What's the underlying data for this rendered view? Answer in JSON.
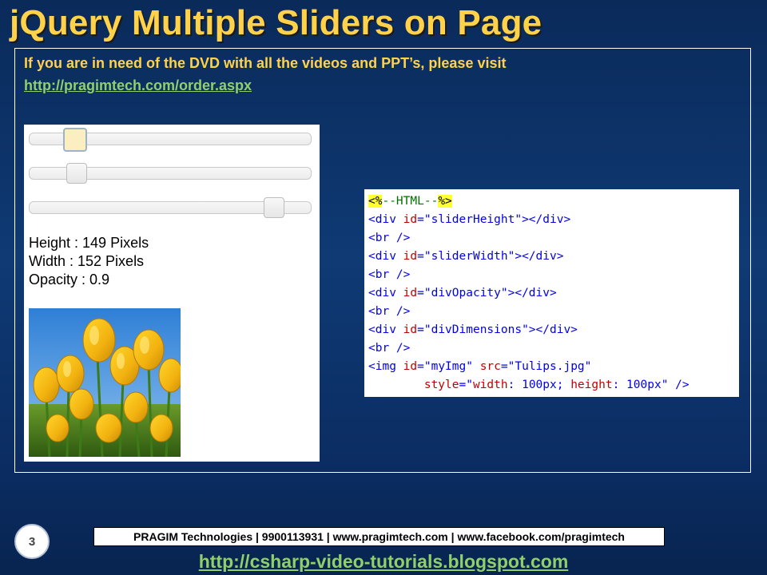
{
  "slide": {
    "title": "jQuery Multiple Sliders on Page",
    "page_number": "3"
  },
  "notice": {
    "text": "If you are in need of the DVD with all the videos and PPT’s, please visit",
    "link": "http://pragimtech.com/order.aspx"
  },
  "demo": {
    "sliders": [
      {
        "name": "height-slider",
        "value_fraction": 0.13,
        "active": true
      },
      {
        "name": "width-slider",
        "value_fraction": 0.14,
        "active": false
      },
      {
        "name": "opacity-slider",
        "value_fraction": 0.9,
        "active": false
      }
    ],
    "height_text": "Height : 149 Pixels",
    "width_text": "Width : 152 Pixels",
    "opacity_text": "Opacity : 0.9",
    "image_subject": "tulips"
  },
  "code": {
    "lines": [
      "<%--HTML--%>",
      "<div id=\"sliderHeight\"></div>",
      "<br />",
      "<div id=\"sliderWidth\"></div>",
      "<br />",
      "<div id=\"divOpacity\"></div>",
      "<br />",
      "<div id=\"divDimensions\"></div>",
      "<br />",
      "<img id=\"myImg\" src=\"Tulips.jpg\"",
      "        style=\"width: 100px; height: 100px\" />"
    ]
  },
  "footer": {
    "company_line": "PRAGIM Technologies | 9900113931 | www.pragimtech.com | www.facebook.com/pragimtech",
    "blog_link": "http://csharp-video-tutorials.blogspot.com"
  },
  "colors": {
    "title": "#ffd24a",
    "link": "#8fd06a",
    "background": "#0f3a74"
  }
}
